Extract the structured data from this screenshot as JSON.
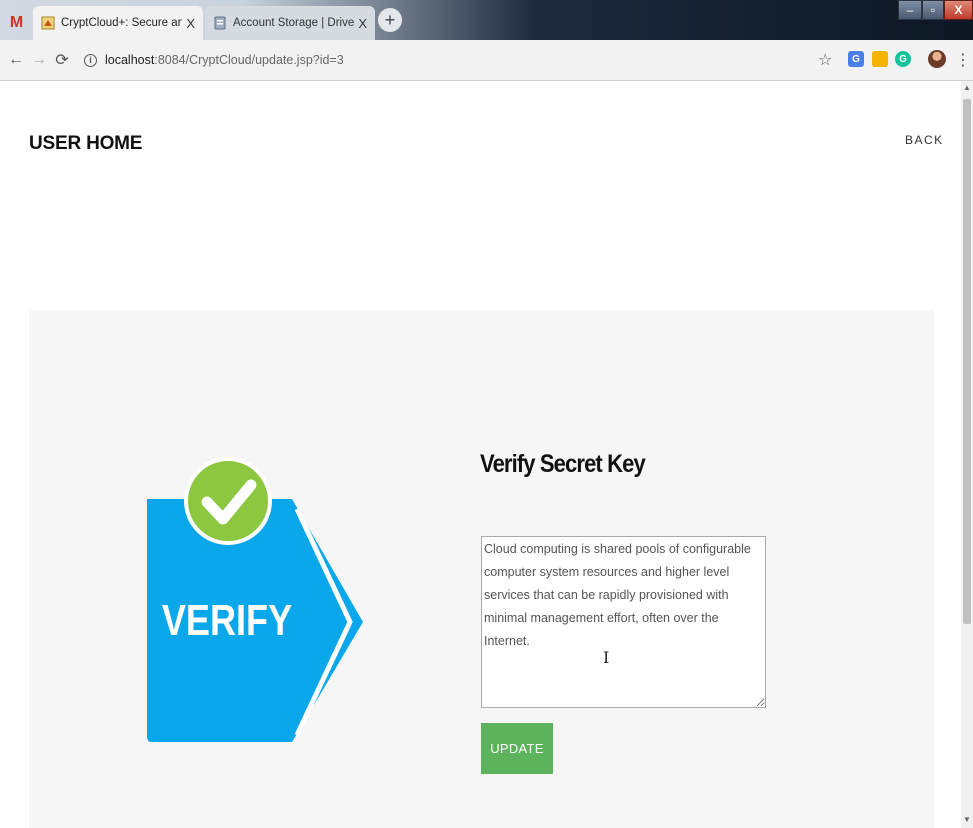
{
  "browser": {
    "tabs": [
      {
        "title": "CryptCloud+: Secure and Expressive",
        "active": true
      },
      {
        "title": "Account Storage | DriveHQ",
        "active": false
      }
    ],
    "gmail_icon": "M",
    "tab_close": "X",
    "new_tab": "+",
    "window_controls": {
      "minimize": "–",
      "maximize": "▫",
      "close": "X"
    },
    "nav": {
      "back": "←",
      "forward": "→",
      "reload": "⟳"
    },
    "url": {
      "host": "localhost",
      "rest": ":8084/CryptCloud/update.jsp?id=3"
    },
    "info_icon": "i",
    "bookmark_icon": "☆",
    "extensions": {
      "translate": "G",
      "keep": "",
      "grammarly": "G"
    },
    "menu_icon": "⋮"
  },
  "page": {
    "title": "USER HOME",
    "back_label": "BACK",
    "graphic_text": "VERIFY",
    "section_title": "Verify Secret Key",
    "textarea_value": "Cloud computing is shared pools of configurable computer system resources and higher level services that can be rapidly provisioned with minimal management effort, often over the Internet.",
    "update_label": "UPDATE"
  },
  "colors": {
    "verify_blue": "#0aa7ea",
    "check_green": "#8dc63f",
    "button_green": "#5cb35c",
    "panel_bg": "#f6f6f6"
  },
  "icons": [
    "gmail-icon",
    "cryptcloud-favicon",
    "drivehq-favicon",
    "info-icon",
    "star-icon",
    "translate-icon",
    "keep-icon",
    "grammarly-icon",
    "avatar",
    "menu-icon",
    "checkmark-icon",
    "text-cursor-icon"
  ]
}
